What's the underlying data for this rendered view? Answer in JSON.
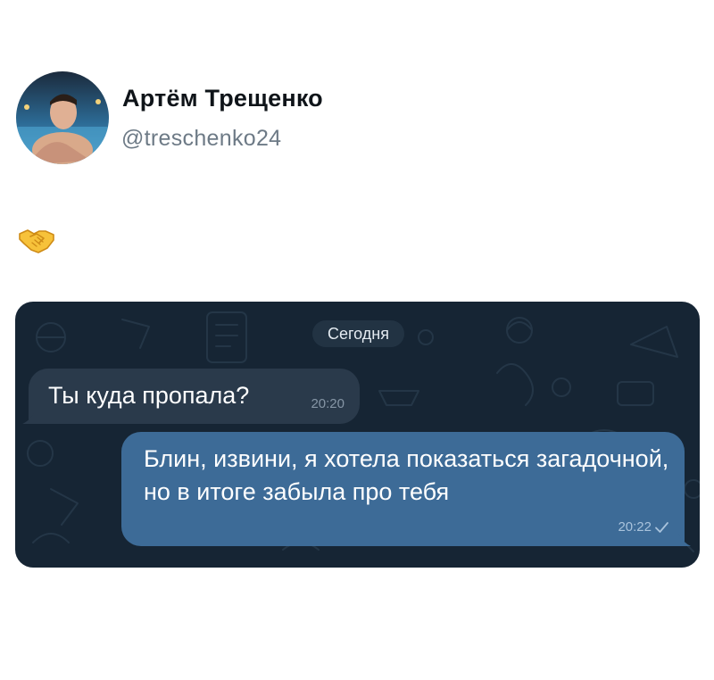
{
  "post": {
    "author_name": "Артём Трещенко",
    "author_handle": "@treschenko24",
    "emoji_icon": "handshake-icon"
  },
  "chat": {
    "date_label": "Сегодня",
    "messages": [
      {
        "direction": "incoming",
        "text": "Ты куда пропала?",
        "time": "20:20"
      },
      {
        "direction": "outgoing",
        "text": "Блин, извини, я хотела показаться загадочной, но в итоге забыла про тебя",
        "time": "20:22",
        "status_icon": "check-icon"
      }
    ]
  },
  "colors": {
    "chat_background": "#162534",
    "incoming_bubble": "#2a3a4b",
    "outgoing_bubble": "#3d6b97",
    "handle_gray": "#6d7a86"
  }
}
